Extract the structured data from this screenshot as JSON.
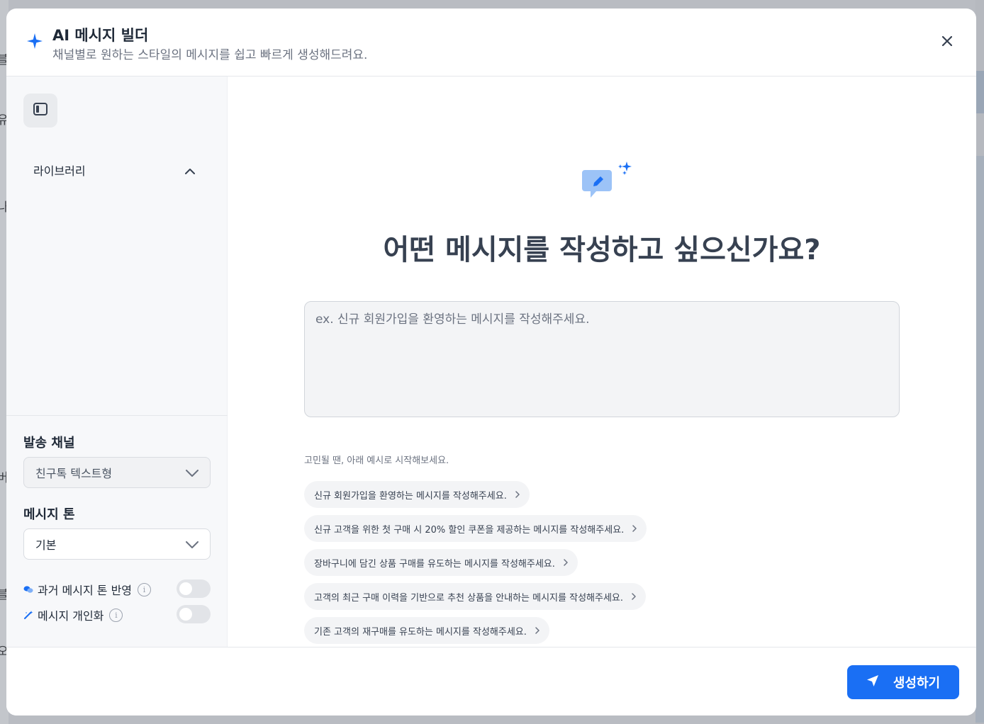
{
  "background": {
    "letters": [
      "블",
      "유",
      "나",
      "버",
      "블",
      "오"
    ]
  },
  "header": {
    "title": "AI 메시지 빌더",
    "subtitle": "채널별로 원하는 스타일의 메시지를 쉽고 빠르게 생성해드려요.",
    "icon": "sparkle-icon",
    "close_icon": "close-icon"
  },
  "sidebar": {
    "panel_toggle_icon": "sidebar-panel-icon",
    "library": {
      "label": "라이브러리",
      "expanded": true
    },
    "channel": {
      "label": "발송 채널",
      "value": "친구톡 텍스트형",
      "disabled": true
    },
    "tone": {
      "label": "메시지 톤",
      "value": "기본"
    },
    "toggles": [
      {
        "label": "과거 메시지 톤 반영",
        "icon": "chat-bubbles-icon",
        "enabled": false
      },
      {
        "label": "메시지 개인화",
        "icon": "magic-wand-icon",
        "enabled": false
      }
    ]
  },
  "main": {
    "hero_icon": "edit-message-sparkle-icon",
    "title": "어떤 메시지를 작성하고 싶으신가요?",
    "prompt": {
      "value": "",
      "placeholder": "ex. 신규 회원가입을 환영하는 메시지를 작성해주세요."
    },
    "examples_hint": "고민될 땐, 아래 예시로 시작해보세요.",
    "examples": [
      "신규 회원가입을 환영하는 메시지를 작성해주세요.",
      "신규 고객을 위한 첫 구매 시 20% 할인 쿠폰을 제공하는 메시지를 작성해주세요.",
      "장바구니에 담긴 상품 구매를 유도하는 메시지를 작성해주세요.",
      "고객의 최근 구매 이력을 기반으로 추천 상품을 안내하는 메시지를 작성해주세요.",
      "기존 고객의 재구매를 유도하는 메시지를 작성해주세요."
    ]
  },
  "footer": {
    "generate_label": "생성하기",
    "generate_icon": "send-icon"
  },
  "colors": {
    "accent": "#1a6ff4",
    "icon_blue_light": "#9cc3f7"
  }
}
